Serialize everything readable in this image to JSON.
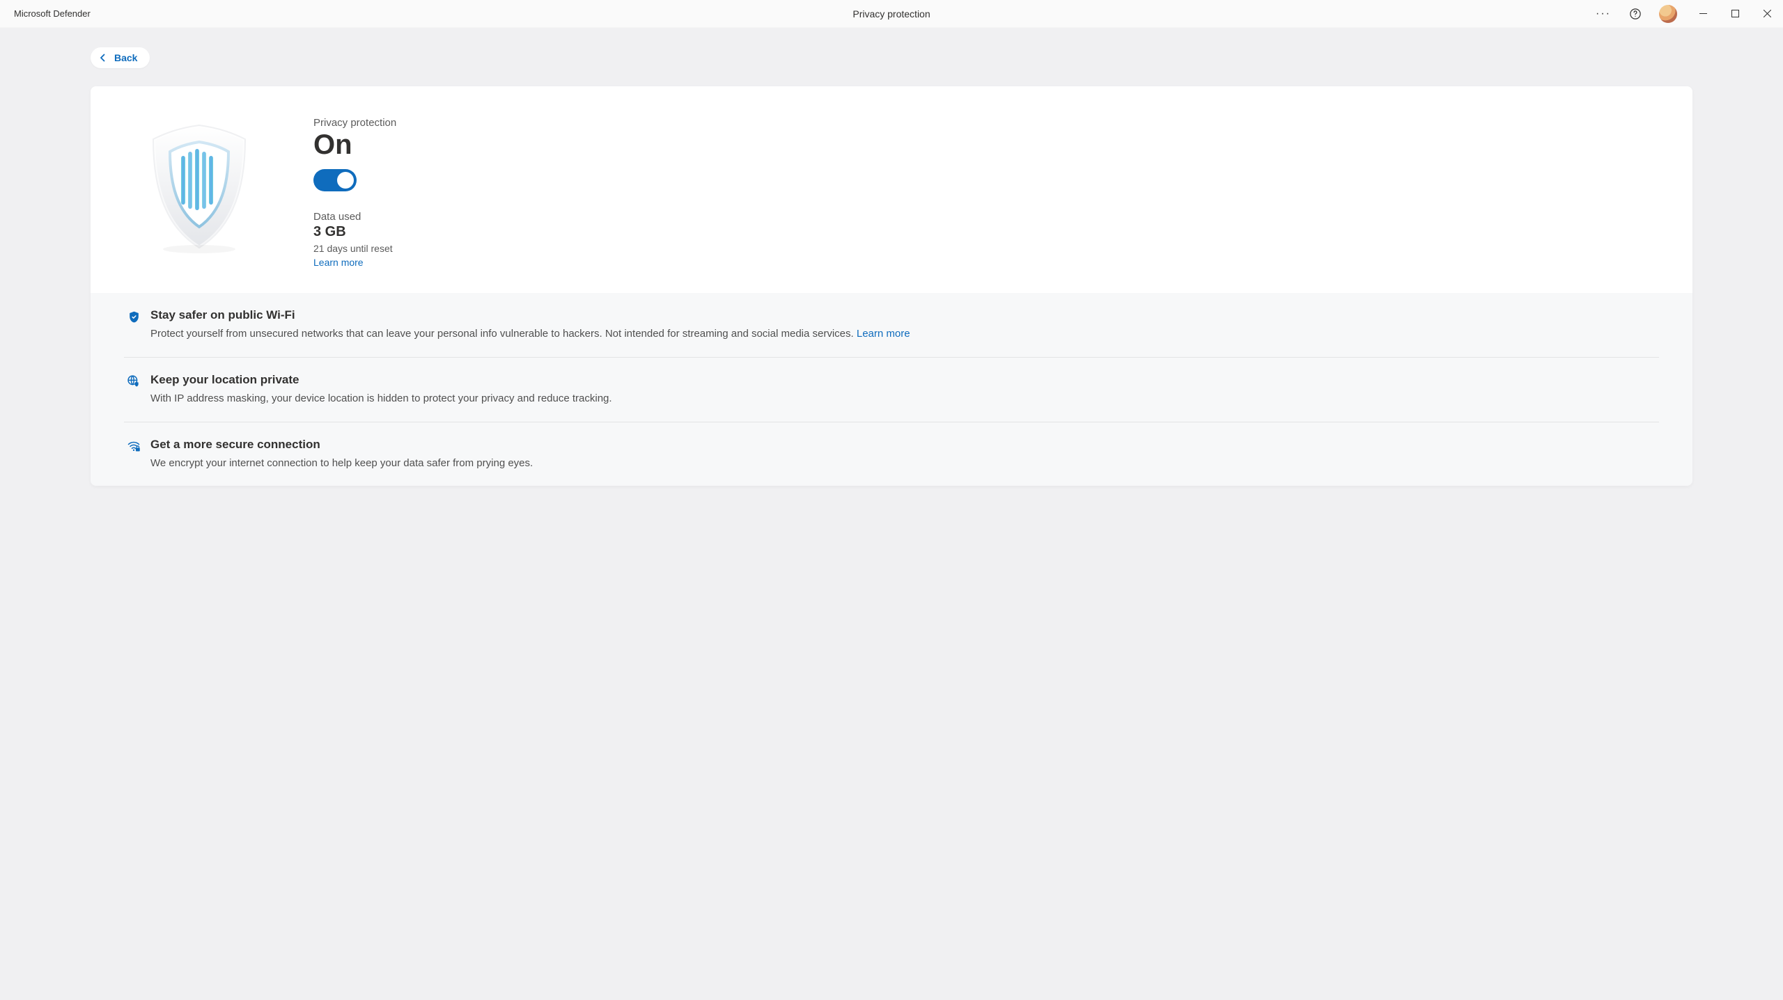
{
  "titlebar": {
    "app_name": "Microsoft Defender",
    "page_title": "Privacy protection"
  },
  "nav": {
    "back_label": "Back"
  },
  "status": {
    "section_label": "Privacy protection",
    "state": "On",
    "toggle_on": true,
    "data_used_label": "Data used",
    "data_used_value": "3 GB",
    "reset_info": "21 days until reset",
    "learn_more_label": "Learn more"
  },
  "features": [
    {
      "icon": "shield-check",
      "title": "Stay safer on public Wi-Fi",
      "desc_a": "Protect yourself from unsecured networks that can leave your personal info vulnerable to hackers. Not intended for streaming and social media services. ",
      "link": "Learn more"
    },
    {
      "icon": "globe-shield",
      "title": "Keep your location private",
      "desc_a": "With IP address masking, your device location is hidden to protect your privacy and reduce tracking.",
      "link": ""
    },
    {
      "icon": "wifi-lock",
      "title": "Get a more secure connection",
      "desc_a": "We encrypt your internet connection to help keep your data safer from prying eyes.",
      "link": ""
    }
  ],
  "colors": {
    "accent": "#0f6cbd"
  }
}
